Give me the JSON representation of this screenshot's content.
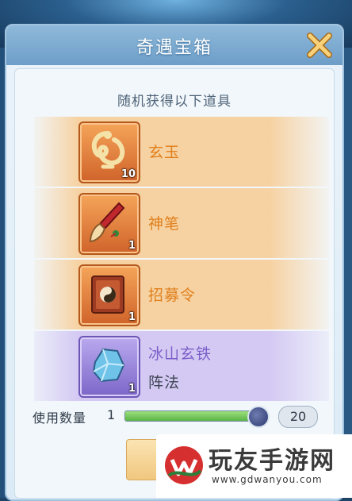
{
  "dialog": {
    "title": "奇遇宝箱",
    "subtitle": "随机获得以下道具"
  },
  "items": [
    {
      "name": "玄玉",
      "count": "10",
      "icon": "jade-icon",
      "style": "orange"
    },
    {
      "name": "神笔",
      "count": "1",
      "icon": "brush-icon",
      "style": "orange"
    },
    {
      "name": "招募令",
      "count": "1",
      "icon": "recruit-book-icon",
      "style": "orange"
    },
    {
      "name": "冰山玄铁",
      "sub": "阵法",
      "count": "1",
      "icon": "ice-ore-icon",
      "style": "purple"
    }
  ],
  "quantity": {
    "label": "使用数量",
    "value": "1",
    "max": "20",
    "fraction": 0.95
  },
  "colors": {
    "accent_orange": "#e07f1c",
    "accent_purple": "#7b5fc9",
    "slider_fill": "#5ab445"
  },
  "watermark": {
    "name": "玩友手游网",
    "url": "www.gdwanyou.com"
  }
}
